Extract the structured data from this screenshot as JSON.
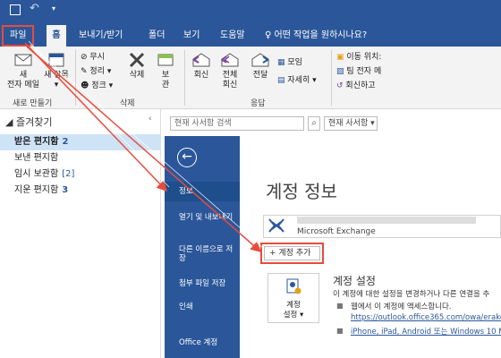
{
  "titlebar": {
    "quick_more": "▾"
  },
  "tabs": {
    "file": "파일",
    "home": "홈",
    "send_receive": "보내기/받기",
    "folder": "폴더",
    "view": "보기",
    "help": "도움말",
    "tell_me": "어떤 작업을 원하시나요?"
  },
  "ribbon": {
    "new_mail_1": "새",
    "new_mail_2": "전자 메일",
    "new_items_1": "새 항목",
    "new_items_2": "▾",
    "ignore": "무시",
    "cleanup": "정리 ▾",
    "junk": "정크 ▾",
    "delete": "삭제",
    "archive_1": "보",
    "archive_2": "관",
    "reply": "회신",
    "reply_all_1": "전체",
    "reply_all_2": "회신",
    "forward": "전달",
    "meeting": "모임",
    "more": "자세히 ▾",
    "move_to": "이동 위치:",
    "team_email": "팀 전자 메",
    "reply_delete": "회신하고 ",
    "group_new": "새로 만들기",
    "group_delete": "삭제",
    "group_respond": "응답"
  },
  "nav": {
    "favorites": "◢ 즐겨찾기",
    "collapse": "‹",
    "folders": [
      {
        "name": "받은 편지함",
        "count": "2"
      },
      {
        "name": "보낸 편지함",
        "count": ""
      },
      {
        "name": "임시 보관함",
        "count": "[2]"
      },
      {
        "name": "지운 편지함",
        "count": "3"
      }
    ]
  },
  "search": {
    "placeholder": "현재 사서함 검색",
    "scope": "현재 사서함 ▾"
  },
  "backstage": {
    "back": "←",
    "items": [
      "정보",
      "열기 및 내보내기",
      "다른 이름으로 저장",
      "첨부 파일 저장",
      "인쇄",
      "Office 계정"
    ],
    "title": "계정 정보",
    "account_type": "Microsoft Exchange",
    "add_account": "+ 계정 추가",
    "settings_btn_1": "계정",
    "settings_btn_2": "설정 ▾",
    "settings_title": "계정 설정",
    "settings_desc": "이 계정에 대한 설정을 변경하거나 다른 연결을 추",
    "bullet": "■",
    "b1": "웹에서 이 계정에 액세스합니다.",
    "link": "https://outlook.office365.com/owa/erakorea.c",
    "b2": "iPhone, iPad, Android 또는 Windows 10 Mob"
  },
  "colors": {
    "accent": "#2b579a",
    "highlight": "#e74c3c"
  }
}
